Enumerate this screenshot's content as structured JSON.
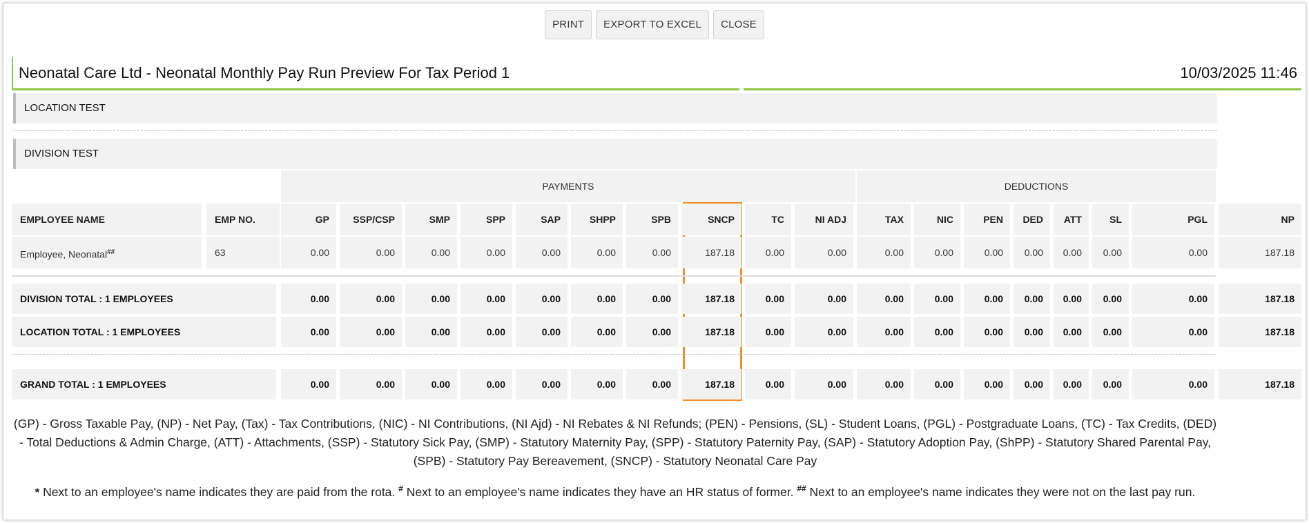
{
  "toolbar": {
    "print": "PRINT",
    "export": "EXPORT TO EXCEL",
    "close": "CLOSE"
  },
  "header": {
    "title": "Neonatal Care Ltd - Neonatal Monthly Pay Run Preview For Tax Period 1",
    "datetime": "10/03/2025 11:46"
  },
  "location_label": "LOCATION TEST",
  "division_label": "DIVISION TEST",
  "groups": {
    "payments": "PAYMENTS",
    "deductions": "DEDUCTIONS"
  },
  "columns": [
    "EMPLOYEE NAME",
    "EMP NO.",
    "GP",
    "SSP/CSP",
    "SMP",
    "SPP",
    "SAP",
    "SHPP",
    "SPB",
    "SNCP",
    "TC",
    "NI ADJ",
    "TAX",
    "NIC",
    "PEN",
    "DED",
    "ATT",
    "SL",
    "PGL",
    "NP"
  ],
  "employee": {
    "name": "Employee, Neonatal",
    "marker": "##",
    "values": [
      "63",
      "0.00",
      "0.00",
      "0.00",
      "0.00",
      "0.00",
      "0.00",
      "0.00",
      "187.18",
      "0.00",
      "0.00",
      "0.00",
      "0.00",
      "0.00",
      "0.00",
      "0.00",
      "0.00",
      "0.00",
      "187.18"
    ]
  },
  "totals": [
    {
      "label": "DIVISION TOTAL : 1 EMPLOYEES",
      "values": [
        "0.00",
        "0.00",
        "0.00",
        "0.00",
        "0.00",
        "0.00",
        "0.00",
        "187.18",
        "0.00",
        "0.00",
        "0.00",
        "0.00",
        "0.00",
        "0.00",
        "0.00",
        "0.00",
        "0.00",
        "187.18"
      ]
    },
    {
      "label": "LOCATION TOTAL : 1 EMPLOYEES",
      "values": [
        "0.00",
        "0.00",
        "0.00",
        "0.00",
        "0.00",
        "0.00",
        "0.00",
        "187.18",
        "0.00",
        "0.00",
        "0.00",
        "0.00",
        "0.00",
        "0.00",
        "0.00",
        "0.00",
        "0.00",
        "187.18"
      ]
    },
    {
      "label": "GRAND TOTAL : 1 EMPLOYEES",
      "values": [
        "0.00",
        "0.00",
        "0.00",
        "0.00",
        "0.00",
        "0.00",
        "0.00",
        "187.18",
        "0.00",
        "0.00",
        "0.00",
        "0.00",
        "0.00",
        "0.00",
        "0.00",
        "0.00",
        "0.00",
        "187.18"
      ]
    }
  ],
  "legend": {
    "abbreviations": "(GP) - Gross Taxable Pay, (NP) - Net Pay, (Tax) - Tax Contributions, (NIC) - NI Contributions, (NI Ajd) - NI Rebates & NI Refunds; (PEN) - Pensions, (SL) - Student Loans, (PGL) - Postgraduate Loans, (TC) - Tax Credits, (DED) - Total Deductions & Admin Charge, (ATT) - Attachments, (SSP) - Statutory Sick Pay, (SMP) - Statutory Maternity Pay, (SPP) - Statutory Paternity Pay, (SAP) - Statutory Adoption Pay, (ShPP) - Statutory Shared Parental Pay, (SPB) - Statutory Pay Bereavement, (SNCP) - Statutory Neonatal Care Pay",
    "note1_marker": "*",
    "note1": "Next to an employee's name indicates they are paid from the rota.",
    "note2_marker": "#",
    "note2": "Next to an employee's name indicates they have an HR status of former.",
    "note3_marker": "##",
    "note3": "Next to an employee's name indicates they were not on the last pay run."
  },
  "colors": {
    "accent_green": "#8dc63f",
    "highlight_orange": "#f28c28",
    "cell_bg": "#f2f2f2"
  }
}
